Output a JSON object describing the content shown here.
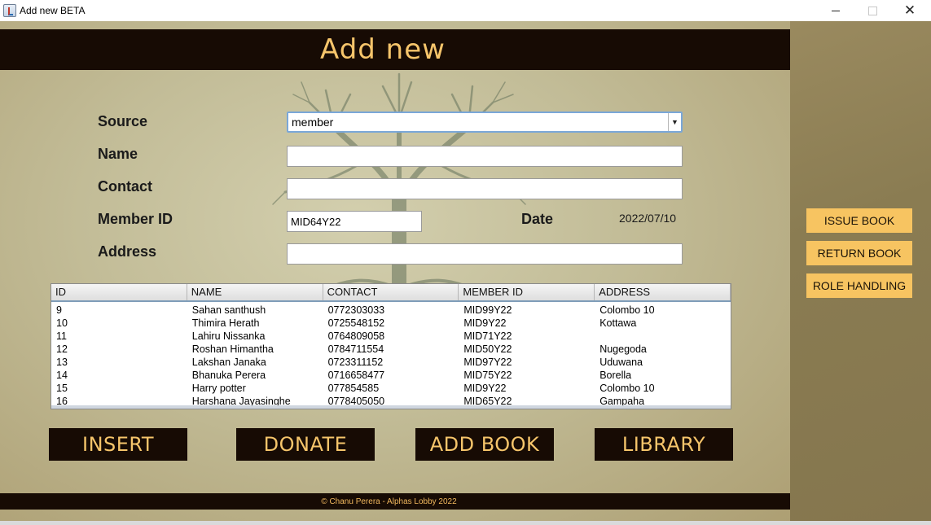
{
  "window": {
    "title": "Add new BETA"
  },
  "header": {
    "title": "Add new"
  },
  "form": {
    "source_label": "Source",
    "source_value": "member",
    "name_label": "Name",
    "name_value": "",
    "contact_label": "Contact",
    "contact_value": "",
    "member_id_label": "Member ID",
    "member_id_value": "MID64Y22",
    "date_label": "Date",
    "date_value": "2022/07/10",
    "address_label": "Address",
    "address_value": ""
  },
  "table": {
    "columns": [
      "ID",
      "NAME",
      "CONTACT",
      "MEMBER ID",
      "ADDRESS"
    ],
    "rows": [
      [
        "9",
        "Sahan santhush",
        "0772303033",
        "MID99Y22",
        "Colombo 10"
      ],
      [
        "10",
        "Thimira Herath",
        "0725548152",
        "MID9Y22",
        "Kottawa"
      ],
      [
        "11",
        "Lahiru Nissanka",
        "0764809058",
        "MID71Y22",
        ""
      ],
      [
        "12",
        "Roshan Himantha",
        "0784711554",
        "MID50Y22",
        "Nugegoda"
      ],
      [
        "13",
        "Lakshan Janaka",
        "0723311152",
        "MID97Y22",
        "Uduwana"
      ],
      [
        "14",
        "Bhanuka Perera",
        "0716658477",
        "MID75Y22",
        "Borella"
      ],
      [
        "15",
        "Harry potter",
        "077854585",
        "MID9Y22",
        "Colombo 10"
      ],
      [
        "16",
        "Harshana Jayasinghe",
        "0778405050",
        "MID65Y22",
        "Gampaha"
      ]
    ]
  },
  "buttons": {
    "insert": "INSERT",
    "donate": "DONATE",
    "add_book": "ADD BOOK",
    "library": "LIBRARY"
  },
  "side_buttons": {
    "issue_book": "ISSUE BOOK",
    "return_book": "RETURN BOOK",
    "role_handling": "ROLE HANDLING"
  },
  "footer": {
    "text": "© Chanu Perera - Alphas Lobby 2022"
  },
  "colors": {
    "header_bg": "#170b04",
    "header_text": "#f6c56b",
    "side_button_bg": "#f7c461"
  }
}
